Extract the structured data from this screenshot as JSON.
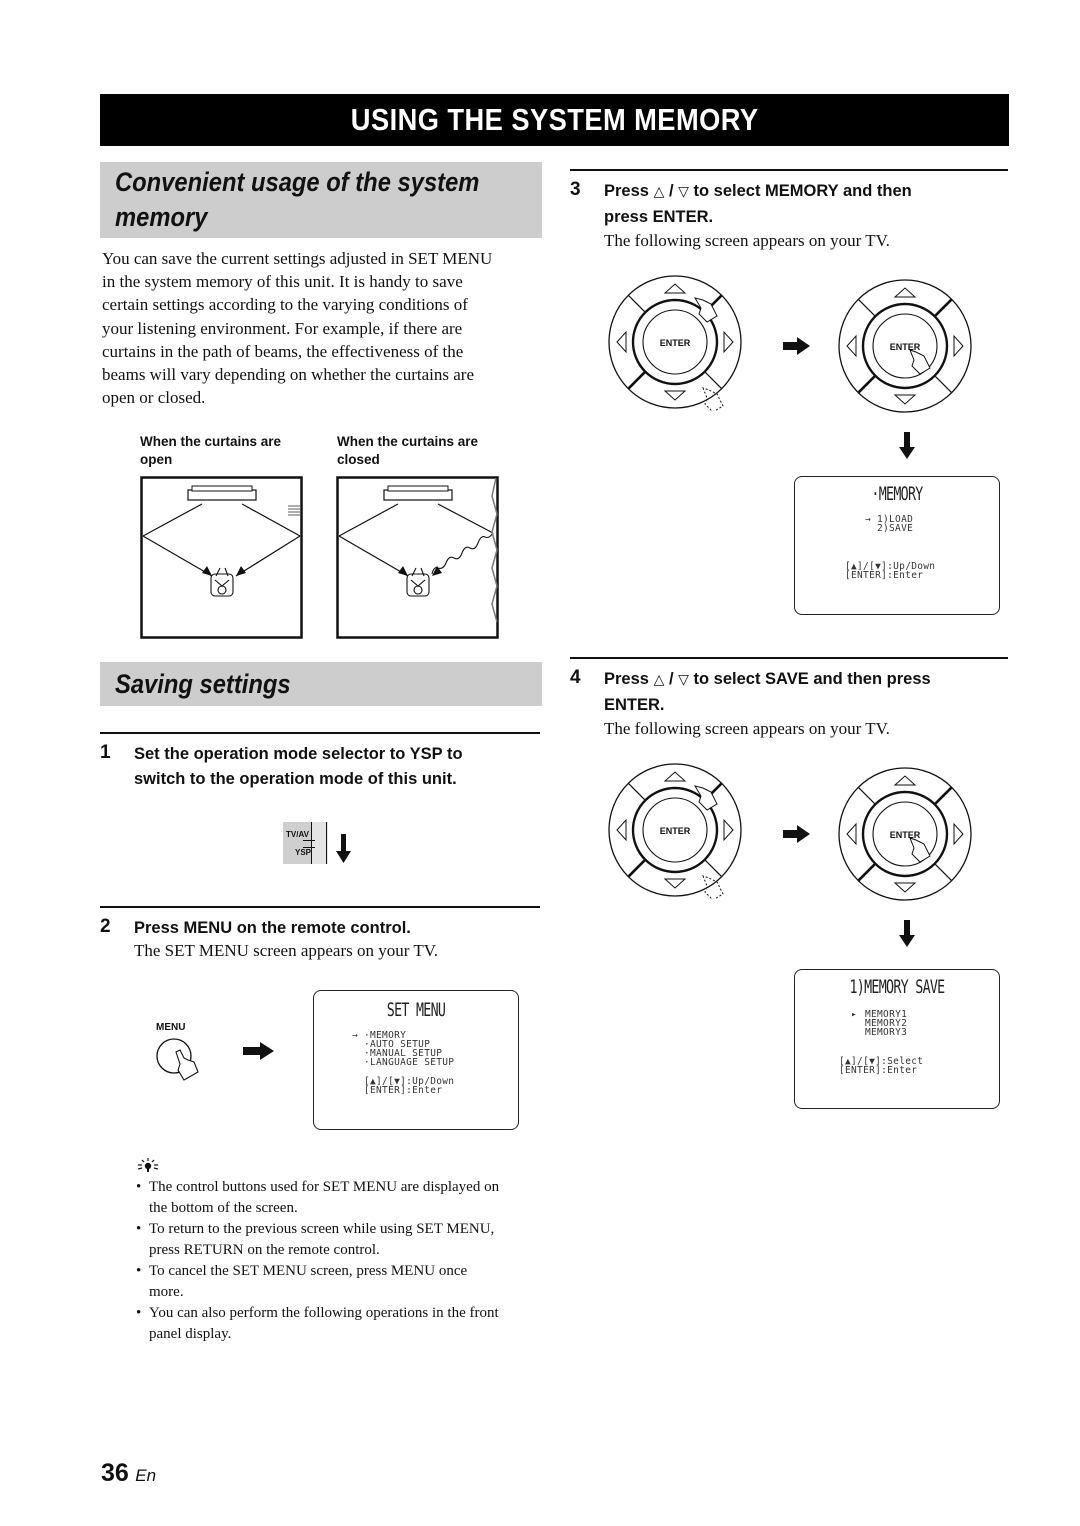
{
  "page": {
    "title": "USING THE SYSTEM MEMORY",
    "page_number": "36",
    "page_lang": "En"
  },
  "section1": {
    "heading_line1": "Convenient usage of the system",
    "heading_line2": "memory",
    "paragraph": [
      "You can save the current settings adjusted in SET MENU",
      "in the system memory of this unit. It is handy to save",
      "certain settings according to the varying conditions of",
      "your listening environment. For example, if there are",
      "curtains in the path of beams, the effectiveness of the",
      "beams will vary depending on whether the curtains are",
      "open or closed."
    ],
    "figure_open_caption_line1": "When the curtains are",
    "figure_open_caption_line2": "open",
    "figure_closed_caption_line1": "When the curtains are",
    "figure_closed_caption_line2": "closed"
  },
  "section2": {
    "heading": "Saving settings",
    "step1": {
      "number": "1",
      "line1": "Set the operation mode selector to YSP to",
      "line2": "switch to the operation mode of this unit.",
      "switch_label_top": "TV/AV",
      "switch_label_bottom": "YSP"
    },
    "step2": {
      "number": "2",
      "title": "Press MENU on the remote control.",
      "subtitle": "The SET MENU screen appears on your TV.",
      "button_label": "MENU",
      "screen": {
        "title": "SET MENU",
        "cursor": "→",
        "items": [
          "·MEMORY",
          "·AUTO SETUP",
          "·MANUAL SETUP",
          "·LANGUAGE SETUP"
        ],
        "help_line1": "[▲]/[▼]:Up/Down",
        "help_line2": "[ENTER]:Enter"
      }
    },
    "tips": {
      "icon": "tip-lightbulb-icon",
      "items": [
        [
          "The control buttons used for SET MENU are displayed on",
          "the bottom of the screen."
        ],
        [
          "To return to the previous screen while using SET MENU,",
          "press RETURN on the remote control."
        ],
        [
          "To cancel the SET MENU screen, press MENU once",
          "more."
        ],
        [
          "You can also perform the following operations in the front",
          "panel display."
        ]
      ]
    }
  },
  "step3": {
    "number": "3",
    "title_press": "Press",
    "up_symbol": "△",
    "slash": "/",
    "down_symbol": "▽",
    "title_rest": "to select MEMORY and then",
    "title_line2": "press ENTER.",
    "subtitle": "The following screen appears on your TV.",
    "enter_label": "ENTER",
    "screen": {
      "title": "·MEMORY",
      "cursor": "→",
      "items": [
        "1)LOAD",
        "2)SAVE"
      ],
      "help_line1": "[▲]/[▼]:Up/Down",
      "help_line2": "[ENTER]:Enter"
    }
  },
  "step4": {
    "number": "4",
    "title_press": "Press",
    "up_symbol": "△",
    "slash": "/",
    "down_symbol": "▽",
    "title_rest": "to select SAVE and then press",
    "title_line2": "ENTER.",
    "subtitle": "The following screen appears on your TV.",
    "enter_label": "ENTER",
    "screen": {
      "title": "1)MEMORY SAVE",
      "cursor": "▸",
      "items": [
        "MEMORY1",
        "MEMORY2",
        "MEMORY3"
      ],
      "help_line1": "[▲]/[▼]:Select",
      "help_line2": "[ENTER]:Enter"
    }
  }
}
